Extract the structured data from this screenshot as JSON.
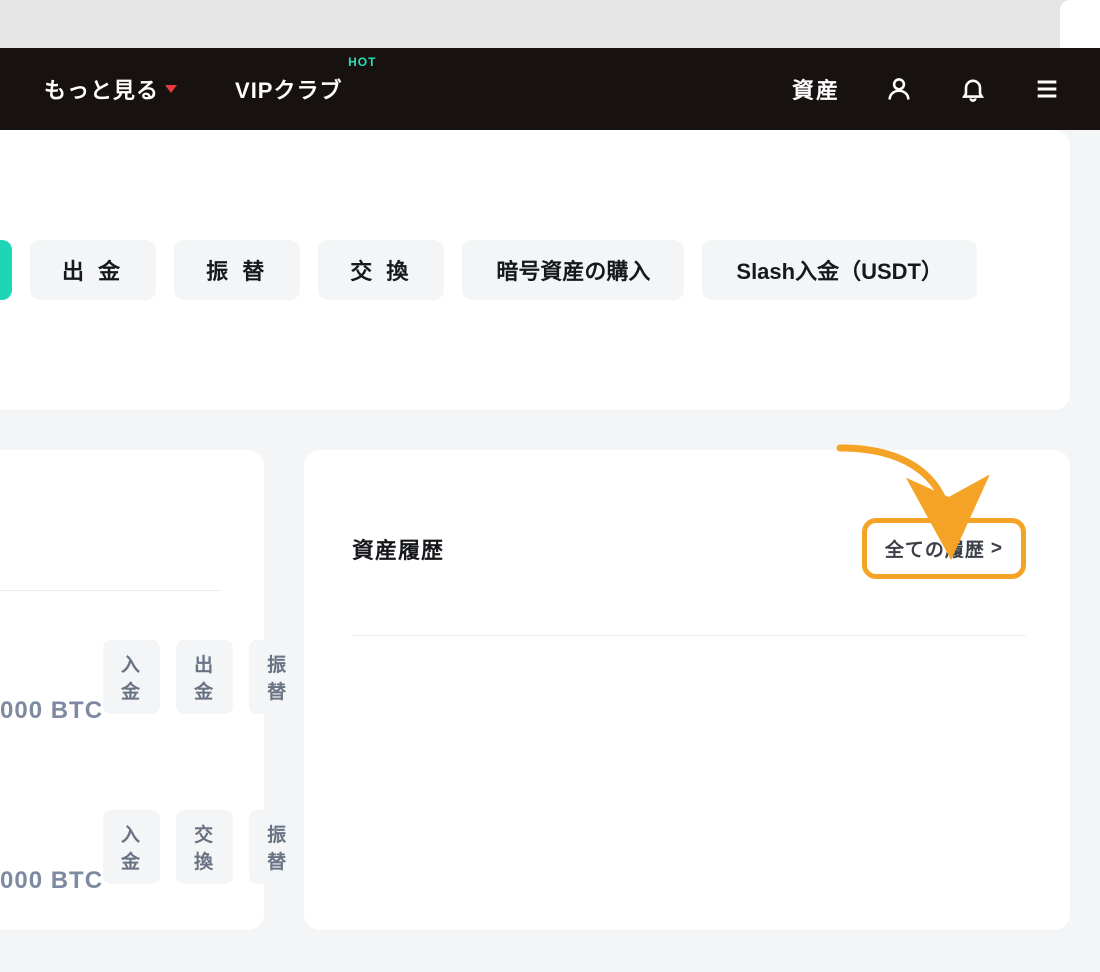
{
  "header": {
    "more_label": "もっと見る",
    "vip_label": "VIPクラブ",
    "hot_badge": "HOT",
    "assets_label": "資産"
  },
  "actions": {
    "withdraw": "出 金",
    "transfer": "振 替",
    "exchange": "交 換",
    "buy_crypto": "暗号資産の購入",
    "slash_deposit": "Slash入金（USDT）"
  },
  "right_panel": {
    "title": "資産履歴",
    "all_history": "全ての履歴",
    "arrow_symbol": ">"
  },
  "asset_rows": [
    {
      "amount": "000 BTC",
      "buttons": [
        "入金",
        "出金",
        "振替"
      ]
    },
    {
      "amount": "000 BTC",
      "buttons": [
        "入金",
        "交換",
        "振替"
      ]
    }
  ]
}
